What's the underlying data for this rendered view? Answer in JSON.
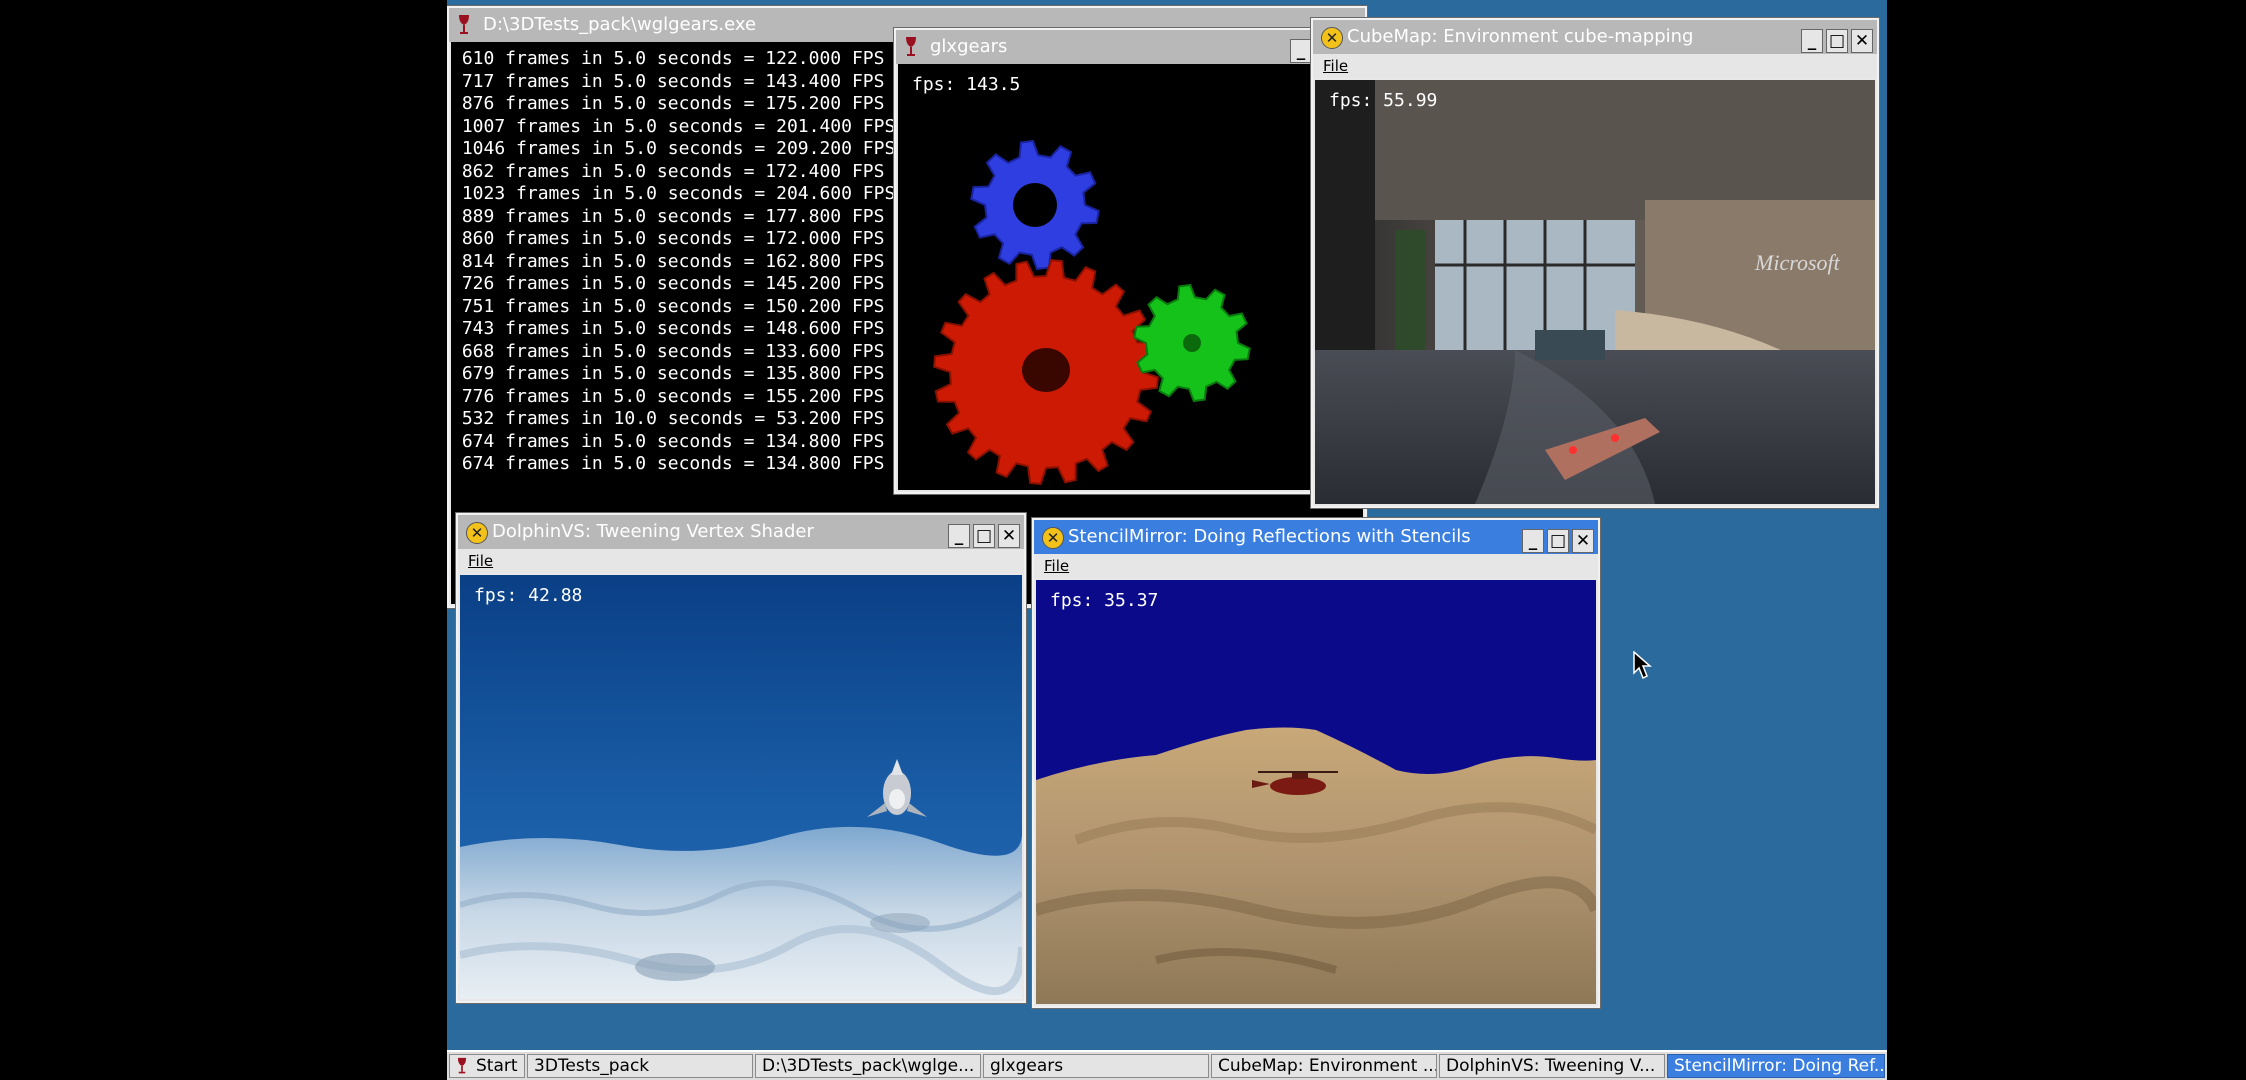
{
  "console_window": {
    "title": "D:\\3DTests_pack\\wglgears.exe",
    "lines": [
      "610 frames in 5.0 seconds = 122.000 FPS",
      "717 frames in 5.0 seconds = 143.400 FPS",
      "876 frames in 5.0 seconds = 175.200 FPS",
      "1007 frames in 5.0 seconds = 201.400 FPS",
      "1046 frames in 5.0 seconds = 209.200 FPS",
      "862 frames in 5.0 seconds = 172.400 FPS",
      "1023 frames in 5.0 seconds = 204.600 FPS",
      "889 frames in 5.0 seconds = 177.800 FPS",
      "860 frames in 5.0 seconds = 172.000 FPS",
      "814 frames in 5.0 seconds = 162.800 FPS",
      "726 frames in 5.0 seconds = 145.200 FPS",
      "751 frames in 5.0 seconds = 150.200 FPS",
      "743 frames in 5.0 seconds = 148.600 FPS",
      "668 frames in 5.0 seconds = 133.600 FPS",
      "679 frames in 5.0 seconds = 135.800 FPS",
      "776 frames in 5.0 seconds = 155.200 FPS",
      "532 frames in 10.0 seconds = 53.200 FPS",
      "674 frames in 5.0 seconds = 134.800 FPS",
      "674 frames in 5.0 seconds = 134.800 FPS"
    ]
  },
  "glxgears": {
    "title": "glxgears",
    "fps": "fps: 143.5"
  },
  "cubemap": {
    "title": "CubeMap: Environment cube-mapping",
    "menu_file": "File",
    "fps": "fps: 55.99",
    "sign_text": "Microsoft"
  },
  "dolphin": {
    "title": "DolphinVS: Tweening Vertex Shader",
    "menu_file": "File",
    "fps": "fps: 42.88"
  },
  "stencil": {
    "title": "StencilMirror: Doing Reflections with Stencils",
    "menu_file": "File",
    "fps": "fps: 35.37"
  },
  "window_controls": {
    "minimize": "_",
    "maximize": "□",
    "close": "✕"
  },
  "icons": {
    "app_icon": "x-circle-icon",
    "wine_icon": "wine-glass-icon"
  },
  "taskbar": {
    "start": "Start",
    "items": [
      "3DTests_pack",
      "D:\\3DTests_pack\\wglge...",
      "glxgears",
      "CubeMap: Environment ...",
      "DolphinVS: Tweening V...",
      "StencilMirror: Doing Ref..."
    ],
    "active_index": 5
  },
  "colors": {
    "desktop": "#2a6a9c",
    "active_title": "#3a7fe0",
    "gear_blue": "#2f3ee0",
    "gear_red": "#cc1a05",
    "gear_green": "#14c21a"
  }
}
